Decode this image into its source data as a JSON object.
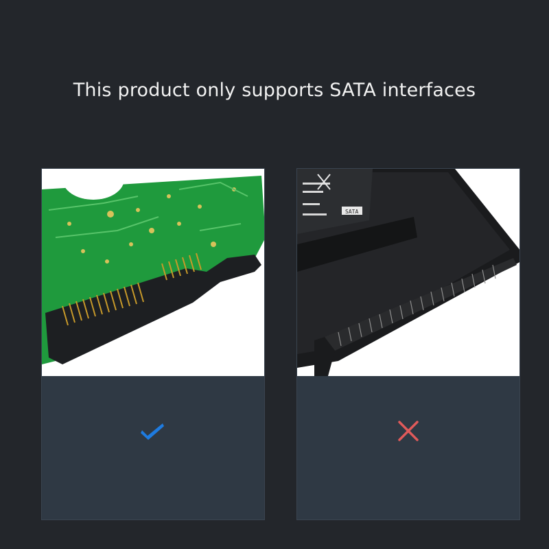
{
  "headline": "This product only supports SATA interfaces",
  "panels": [
    {
      "icon": "checkmark-icon",
      "color": "#1e7be0"
    },
    {
      "icon": "cross-icon",
      "color": "#e05a5a"
    }
  ],
  "drive_label_text": "SATA"
}
